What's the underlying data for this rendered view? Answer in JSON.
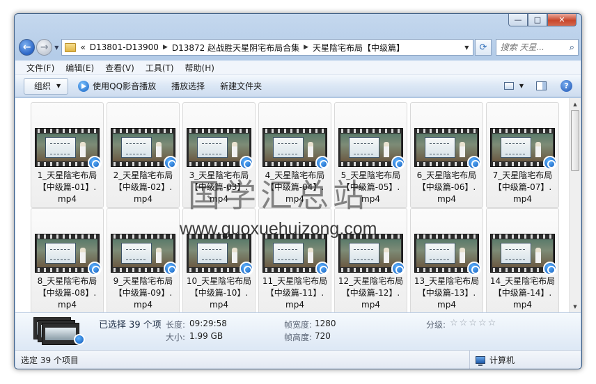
{
  "window": {
    "caption_buttons": {
      "min": "—",
      "max": "□",
      "close": "✕"
    }
  },
  "nav": {
    "back_glyph": "←",
    "forward_glyph": "→",
    "chevron": "«",
    "breadcrumbs": [
      "D13801-D13900",
      "D13872 赵战胜天星阴宅布局合集",
      "天星陰宅布局【中级篇】"
    ],
    "breadcrumb_separator": "▶",
    "search_placeholder": "搜索 天星..."
  },
  "menu": [
    "文件(F)",
    "编辑(E)",
    "查看(V)",
    "工具(T)",
    "帮助(H)"
  ],
  "toolbar": {
    "organize": "组织",
    "play_qq": "使用QQ影音播放",
    "play_selection": "播放选择",
    "new_folder": "新建文件夹",
    "help_glyph": "?"
  },
  "files": [
    {
      "name": "1_天星陰宅布局【中级篇-01】.mp4",
      "line1": "1_天星陰宅布局",
      "line2": "【中级篇-01】.",
      "line3": "mp4"
    },
    {
      "name": "2_天星陰宅布局【中级篇-02】.mp4",
      "line1": "2_天星陰宅布局",
      "line2": "【中级篇-02】.",
      "line3": "mp4"
    },
    {
      "name": "3_天星陰宅布局【中级篇-03】.mp4",
      "line1": "3_天星陰宅布局",
      "line2": "【中级篇-03】.",
      "line3": "mp4"
    },
    {
      "name": "4_天星陰宅布局【中级篇-04】.mp4",
      "line1": "4_天星陰宅布局",
      "line2": "【中级篇-04】.",
      "line3": "mp4"
    },
    {
      "name": "5_天星陰宅布局【中级篇-05】.mp4",
      "line1": "5_天星陰宅布局",
      "line2": "【中级篇-05】.",
      "line3": "mp4"
    },
    {
      "name": "6_天星陰宅布局【中级篇-06】.mp4",
      "line1": "6_天星陰宅布局",
      "line2": "【中级篇-06】.",
      "line3": "mp4"
    },
    {
      "name": "7_天星陰宅布局【中级篇-07】.mp4",
      "line1": "7_天星陰宅布局",
      "line2": "【中级篇-07】.",
      "line3": "mp4"
    },
    {
      "name": "8_天星陰宅布局【中级篇-08】.mp4",
      "line1": "8_天星陰宅布局",
      "line2": "【中级篇-08】.",
      "line3": "mp4"
    },
    {
      "name": "9_天星陰宅布局【中级篇-09】.mp4",
      "line1": "9_天星陰宅布局",
      "line2": "【中级篇-09】.",
      "line3": "mp4"
    },
    {
      "name": "10_天星陰宅布局【中级篇-10】.mp4",
      "line1": "10_天星陰宅布局",
      "line2": "【中级篇-10】.",
      "line3": "mp4"
    },
    {
      "name": "11_天星陰宅布局【中级篇-11】.mp4",
      "line1": "11_天星陰宅布局",
      "line2": "【中级篇-11】.",
      "line3": "mp4"
    },
    {
      "name": "12_天星陰宅布局【中级篇-12】.mp4",
      "line1": "12_天星陰宅布局",
      "line2": "【中级篇-12】.",
      "line3": "mp4"
    },
    {
      "name": "13_天星陰宅布局【中级篇-13】.mp4",
      "line1": "13_天星陰宅布局",
      "line2": "【中级篇-13】.",
      "line3": "mp4"
    },
    {
      "name": "14_天星陰宅布局【中级篇-14】.mp4",
      "line1": "14_天星陰宅布局",
      "line2": "【中级篇-14】.",
      "line3": "mp4"
    }
  ],
  "watermark": {
    "cn": "国学汇总站",
    "en": "www.guoxuehuizong.com"
  },
  "details": {
    "selected": "已选择 39 个项",
    "length_label": "长度:",
    "length_value": "09:29:58",
    "size_label": "大小:",
    "size_value": "1.99 GB",
    "frame_width_label": "帧宽度:",
    "frame_width_value": "1280",
    "frame_height_label": "帧高度:",
    "frame_height_value": "720",
    "rating_label": "分级:",
    "rating_stars": "☆☆☆☆☆",
    "rating_value": 0
  },
  "status": {
    "left": "选定 39 个项目",
    "right": "计算机"
  }
}
